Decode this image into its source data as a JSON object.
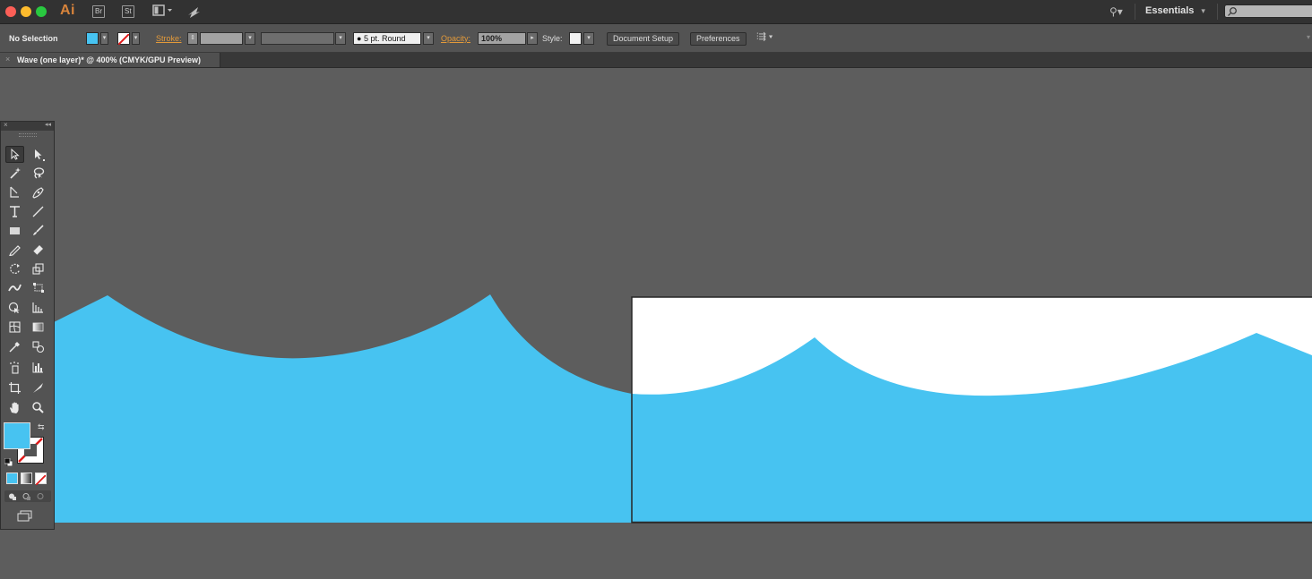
{
  "app": {
    "logo": "Ai",
    "bridge": "Br",
    "stock": "St",
    "workspace": "Essentials",
    "search_placeholder": ""
  },
  "control_bar": {
    "selection": "No Selection",
    "stroke_label": "Stroke:",
    "brush_profile": "5 pt. Round",
    "opacity_label": "Opacity:",
    "opacity_value": "100%",
    "style_label": "Style:",
    "document_setup": "Document Setup",
    "preferences": "Preferences"
  },
  "document": {
    "tab_title": "Wave (one layer)* @ 400% (CMYK/GPU Preview)"
  },
  "colors": {
    "fill": "#47c3f1",
    "canvas_bg": "#5d5d5d",
    "artboard": "#ffffff",
    "accent_label": "#e39a3a"
  },
  "tools": [
    "selection-tool",
    "direct-selection-tool",
    "magic-wand-tool",
    "lasso-tool",
    "pen-tool",
    "curvature-tool",
    "type-tool",
    "line-segment-tool",
    "rectangle-tool",
    "paintbrush-tool",
    "pencil-tool",
    "eraser-tool",
    "rotate-tool",
    "scale-tool",
    "width-tool",
    "free-transform-tool",
    "shape-builder-tool",
    "perspective-grid-tool",
    "mesh-tool",
    "gradient-tool",
    "eyedropper-tool",
    "blend-tool",
    "symbol-sprayer-tool",
    "column-graph-tool",
    "artboard-tool",
    "slice-tool",
    "hand-tool",
    "zoom-tool"
  ]
}
